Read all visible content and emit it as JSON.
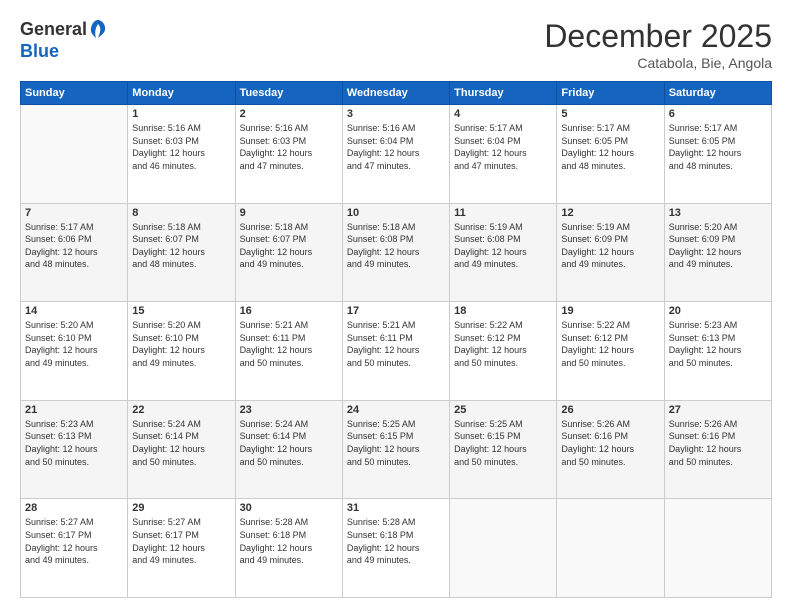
{
  "header": {
    "logo_general": "General",
    "logo_blue": "Blue",
    "month_title": "December 2025",
    "subtitle": "Catabola, Bie, Angola"
  },
  "weekdays": [
    "Sunday",
    "Monday",
    "Tuesday",
    "Wednesday",
    "Thursday",
    "Friday",
    "Saturday"
  ],
  "weeks": [
    [
      {
        "day": "",
        "info": ""
      },
      {
        "day": "1",
        "info": "Sunrise: 5:16 AM\nSunset: 6:03 PM\nDaylight: 12 hours\nand 46 minutes."
      },
      {
        "day": "2",
        "info": "Sunrise: 5:16 AM\nSunset: 6:03 PM\nDaylight: 12 hours\nand 47 minutes."
      },
      {
        "day": "3",
        "info": "Sunrise: 5:16 AM\nSunset: 6:04 PM\nDaylight: 12 hours\nand 47 minutes."
      },
      {
        "day": "4",
        "info": "Sunrise: 5:17 AM\nSunset: 6:04 PM\nDaylight: 12 hours\nand 47 minutes."
      },
      {
        "day": "5",
        "info": "Sunrise: 5:17 AM\nSunset: 6:05 PM\nDaylight: 12 hours\nand 48 minutes."
      },
      {
        "day": "6",
        "info": "Sunrise: 5:17 AM\nSunset: 6:05 PM\nDaylight: 12 hours\nand 48 minutes."
      }
    ],
    [
      {
        "day": "7",
        "info": "Sunrise: 5:17 AM\nSunset: 6:06 PM\nDaylight: 12 hours\nand 48 minutes."
      },
      {
        "day": "8",
        "info": "Sunrise: 5:18 AM\nSunset: 6:07 PM\nDaylight: 12 hours\nand 48 minutes."
      },
      {
        "day": "9",
        "info": "Sunrise: 5:18 AM\nSunset: 6:07 PM\nDaylight: 12 hours\nand 49 minutes."
      },
      {
        "day": "10",
        "info": "Sunrise: 5:18 AM\nSunset: 6:08 PM\nDaylight: 12 hours\nand 49 minutes."
      },
      {
        "day": "11",
        "info": "Sunrise: 5:19 AM\nSunset: 6:08 PM\nDaylight: 12 hours\nand 49 minutes."
      },
      {
        "day": "12",
        "info": "Sunrise: 5:19 AM\nSunset: 6:09 PM\nDaylight: 12 hours\nand 49 minutes."
      },
      {
        "day": "13",
        "info": "Sunrise: 5:20 AM\nSunset: 6:09 PM\nDaylight: 12 hours\nand 49 minutes."
      }
    ],
    [
      {
        "day": "14",
        "info": "Sunrise: 5:20 AM\nSunset: 6:10 PM\nDaylight: 12 hours\nand 49 minutes."
      },
      {
        "day": "15",
        "info": "Sunrise: 5:20 AM\nSunset: 6:10 PM\nDaylight: 12 hours\nand 49 minutes."
      },
      {
        "day": "16",
        "info": "Sunrise: 5:21 AM\nSunset: 6:11 PM\nDaylight: 12 hours\nand 50 minutes."
      },
      {
        "day": "17",
        "info": "Sunrise: 5:21 AM\nSunset: 6:11 PM\nDaylight: 12 hours\nand 50 minutes."
      },
      {
        "day": "18",
        "info": "Sunrise: 5:22 AM\nSunset: 6:12 PM\nDaylight: 12 hours\nand 50 minutes."
      },
      {
        "day": "19",
        "info": "Sunrise: 5:22 AM\nSunset: 6:12 PM\nDaylight: 12 hours\nand 50 minutes."
      },
      {
        "day": "20",
        "info": "Sunrise: 5:23 AM\nSunset: 6:13 PM\nDaylight: 12 hours\nand 50 minutes."
      }
    ],
    [
      {
        "day": "21",
        "info": "Sunrise: 5:23 AM\nSunset: 6:13 PM\nDaylight: 12 hours\nand 50 minutes."
      },
      {
        "day": "22",
        "info": "Sunrise: 5:24 AM\nSunset: 6:14 PM\nDaylight: 12 hours\nand 50 minutes."
      },
      {
        "day": "23",
        "info": "Sunrise: 5:24 AM\nSunset: 6:14 PM\nDaylight: 12 hours\nand 50 minutes."
      },
      {
        "day": "24",
        "info": "Sunrise: 5:25 AM\nSunset: 6:15 PM\nDaylight: 12 hours\nand 50 minutes."
      },
      {
        "day": "25",
        "info": "Sunrise: 5:25 AM\nSunset: 6:15 PM\nDaylight: 12 hours\nand 50 minutes."
      },
      {
        "day": "26",
        "info": "Sunrise: 5:26 AM\nSunset: 6:16 PM\nDaylight: 12 hours\nand 50 minutes."
      },
      {
        "day": "27",
        "info": "Sunrise: 5:26 AM\nSunset: 6:16 PM\nDaylight: 12 hours\nand 50 minutes."
      }
    ],
    [
      {
        "day": "28",
        "info": "Sunrise: 5:27 AM\nSunset: 6:17 PM\nDaylight: 12 hours\nand 49 minutes."
      },
      {
        "day": "29",
        "info": "Sunrise: 5:27 AM\nSunset: 6:17 PM\nDaylight: 12 hours\nand 49 minutes."
      },
      {
        "day": "30",
        "info": "Sunrise: 5:28 AM\nSunset: 6:18 PM\nDaylight: 12 hours\nand 49 minutes."
      },
      {
        "day": "31",
        "info": "Sunrise: 5:28 AM\nSunset: 6:18 PM\nDaylight: 12 hours\nand 49 minutes."
      },
      {
        "day": "",
        "info": ""
      },
      {
        "day": "",
        "info": ""
      },
      {
        "day": "",
        "info": ""
      }
    ]
  ]
}
